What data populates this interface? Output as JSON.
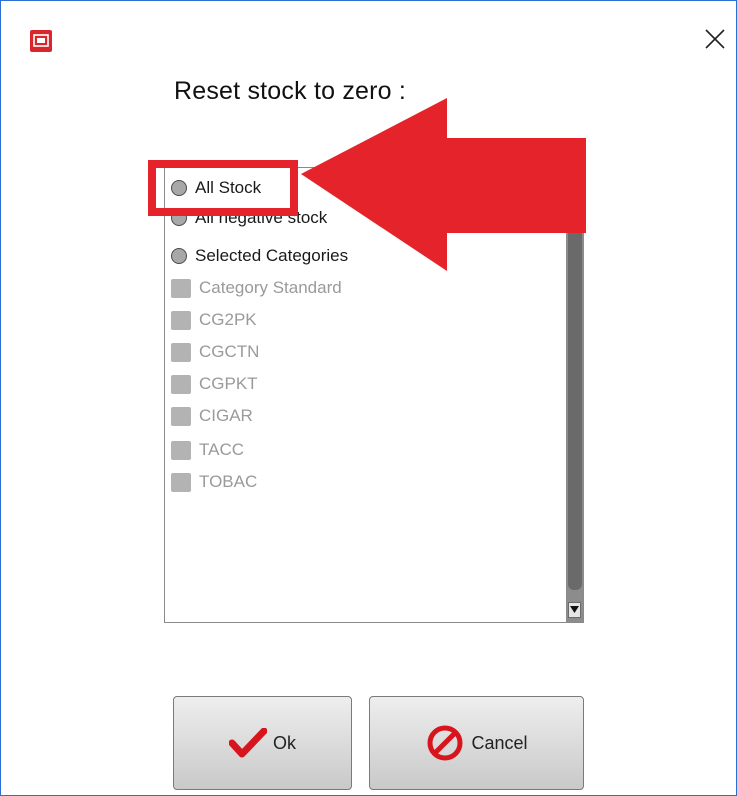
{
  "dialog": {
    "heading": "Reset stock to zero :"
  },
  "options": [
    {
      "label": "All Stock",
      "type": "radio"
    },
    {
      "label": "All negative stock",
      "type": "radio"
    },
    {
      "label": "Selected Categories",
      "type": "radio"
    }
  ],
  "categories": [
    "Category Standard",
    "CG2PK",
    "CGCTN",
    "CGPKT",
    "CIGAR",
    "TACC",
    "TOBAC"
  ],
  "buttons": {
    "ok_label": "Ok",
    "cancel_label": "Cancel"
  },
  "icons": {
    "app": "app-logo-icon",
    "close": "close-icon",
    "ok": "checkmark-icon",
    "cancel": "no-entry-icon",
    "annotation": "red-arrow-annotation"
  },
  "colors": {
    "annotation": "#e5232a",
    "window_border": "#2b6fd6"
  }
}
